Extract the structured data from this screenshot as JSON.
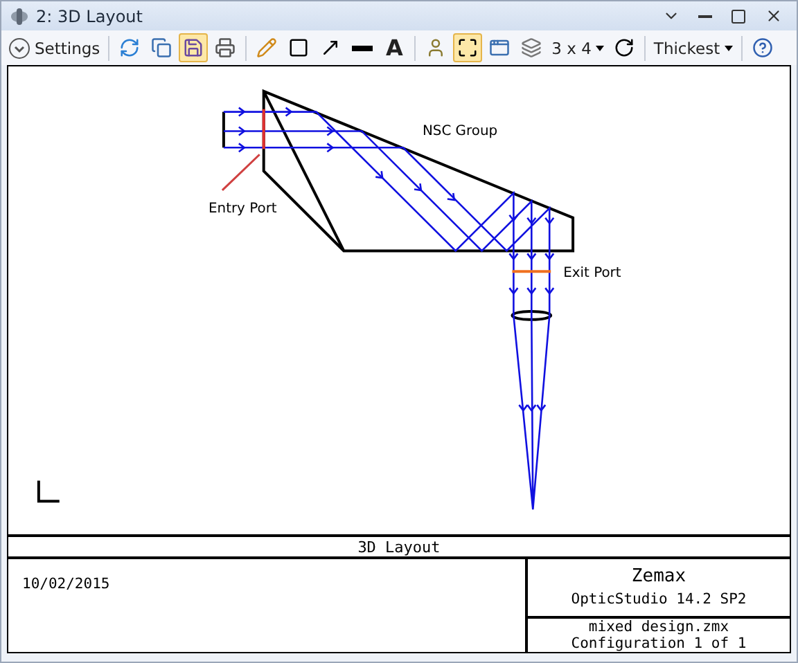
{
  "window": {
    "title": "2: 3D Layout"
  },
  "toolbar": {
    "settings": "Settings",
    "text_tool": "A",
    "grid": "3 x 4",
    "thickness": "Thickest",
    "buttons": [
      {
        "pressed": false
      },
      {
        "pressed": false
      },
      {
        "pressed": true
      },
      {
        "pressed": false
      },
      {
        "pressed": false
      },
      {
        "pressed": false
      },
      {
        "pressed": false
      },
      {
        "pressed": false
      },
      {
        "pressed": false
      },
      {
        "pressed": true
      },
      {
        "pressed": false
      },
      {
        "pressed": false
      },
      {
        "pressed": false
      },
      {
        "pressed": false
      }
    ]
  },
  "layout": {
    "labels": [
      "NSC Group",
      "Entry Port",
      "Exit Port"
    ]
  },
  "footer": {
    "title": "3D Layout",
    "date": "10/02/2015",
    "company": "Zemax",
    "product": "OpticStudio 14.2 SP2",
    "file": "mixed design.zmx",
    "configuration": "Configuration 1 of 1"
  }
}
